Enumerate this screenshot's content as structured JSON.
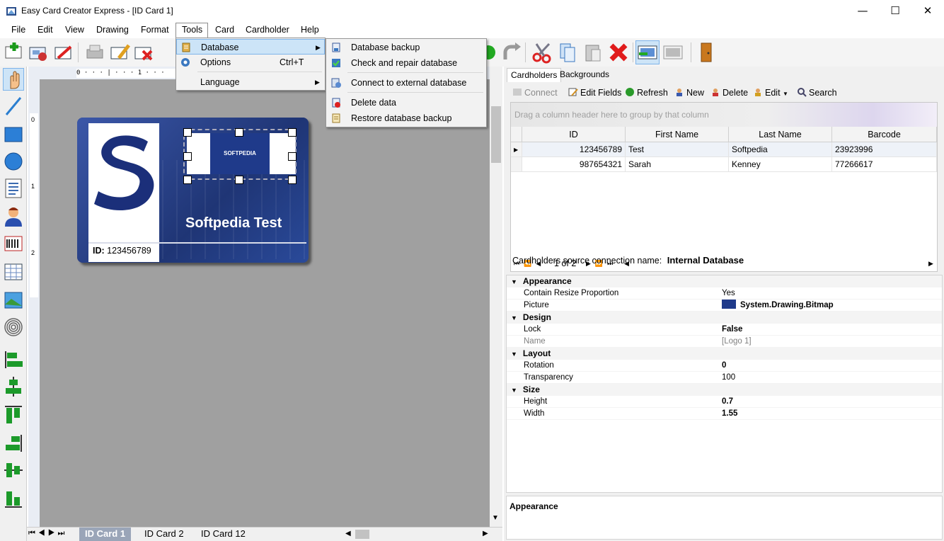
{
  "window": {
    "title": "Easy Card Creator Express - [ID Card 1]"
  },
  "menubar": {
    "items": [
      "File",
      "Edit",
      "View",
      "Drawing",
      "Format",
      "Tools",
      "Card",
      "Cardholder",
      "Help"
    ]
  },
  "tools_menu": {
    "database": "Database",
    "options": "Options",
    "options_shortcut": "Ctrl+T",
    "language": "Language"
  },
  "database_menu": {
    "backup": "Database backup",
    "check": "Check and repair database",
    "connect": "Connect to external database",
    "delete": "Delete data",
    "restore": "Restore database backup"
  },
  "ruler": {
    "top_marks": "0 · · · | · · · 1 · · ·",
    "left_marks": [
      "0",
      "1",
      "2"
    ]
  },
  "card": {
    "logo_text": "SOFTPEDIA",
    "name": "Softpedia Test",
    "id_label": "ID:",
    "id_value": "123456789"
  },
  "sheet_tabs": [
    "ID Card 1",
    "ID Card 2",
    "ID Card 12"
  ],
  "right_panel": {
    "tabs": [
      "Cardholders",
      "Backgrounds"
    ],
    "toolbar": {
      "connect": "Connect",
      "edit_fields": "Edit Fields",
      "refresh": "Refresh",
      "new": "New",
      "delete": "Delete",
      "edit": "Edit",
      "search": "Search"
    },
    "group_hint": "Drag a column header here to group by that column",
    "columns": [
      "ID",
      "First Name",
      "Last Name",
      "Barcode"
    ],
    "rows": [
      [
        "123456789",
        "Test",
        "Softpedia",
        "23923996"
      ],
      [
        "987654321",
        "Sarah",
        "Kenney",
        "77266617"
      ]
    ],
    "pager": "1 of 2",
    "source_label": "Cardholders source connection name:",
    "source_value": "Internal Database"
  },
  "properties": {
    "appearance": "Appearance",
    "contain_resize": "Contain Resize Proportion",
    "contain_resize_val": "Yes",
    "picture": "Picture",
    "picture_val": "System.Drawing.Bitmap",
    "design": "Design",
    "lock": "Lock",
    "lock_val": "False",
    "name": "Name",
    "name_val": "[Logo 1]",
    "layout": "Layout",
    "rotation": "Rotation",
    "rotation_val": "0",
    "transparency": "Transparency",
    "transparency_val": "100",
    "size": "Size",
    "height": "Height",
    "height_val": "0.7",
    "width": "Width",
    "width_val": "1.55",
    "description_title": "Appearance"
  },
  "colors": {
    "accent": "#1f3a8a",
    "canvas": "#a0a0a0",
    "menu_highlight": "#cce4f7"
  }
}
